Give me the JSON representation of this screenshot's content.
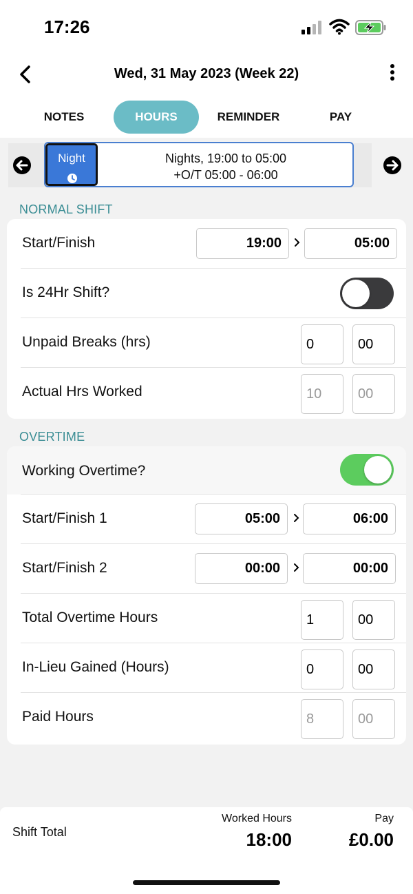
{
  "status_bar": {
    "time": "17:26"
  },
  "header": {
    "title": "Wed, 31 May 2023 (Week 22)"
  },
  "tabs": [
    {
      "label": "NOTES",
      "active": false
    },
    {
      "label": "HOURS",
      "active": true
    },
    {
      "label": "REMINDER",
      "active": false
    },
    {
      "label": "PAY",
      "active": false
    }
  ],
  "shift": {
    "badge": "Night",
    "line1": "Nights, 19:00 to 05:00",
    "line2": "+O/T 05:00 - 06:00"
  },
  "normal_shift": {
    "title": "NORMAL SHIFT",
    "start_finish": {
      "label": "Start/Finish",
      "start": "19:00",
      "finish": "05:00"
    },
    "is_24hr": {
      "label": "Is 24Hr Shift?",
      "on": false
    },
    "unpaid_breaks": {
      "label": "Unpaid Breaks (hrs)",
      "hours": "0",
      "minutes": "00"
    },
    "actual_hrs": {
      "label": "Actual Hrs Worked",
      "hours": "10",
      "minutes": "00"
    }
  },
  "overtime": {
    "title": "OVERTIME",
    "working_overtime": {
      "label": "Working Overtime?",
      "on": true
    },
    "start_finish_1": {
      "label": "Start/Finish 1",
      "start": "05:00",
      "finish": "06:00"
    },
    "start_finish_2": {
      "label": "Start/Finish 2",
      "start": "00:00",
      "finish": "00:00"
    },
    "total_ot": {
      "label": "Total Overtime Hours",
      "hours": "1",
      "minutes": "00"
    },
    "in_lieu": {
      "label": "In-Lieu Gained (Hours)",
      "hours": "0",
      "minutes": "00"
    },
    "paid_hours": {
      "label": "Paid Hours",
      "hours": "8",
      "minutes": "00"
    }
  },
  "footer": {
    "label": "Shift Total",
    "worked_label": "Worked Hours",
    "worked_value": "18:00",
    "pay_label": "Pay",
    "pay_value": "£0.00"
  },
  "colors": {
    "accent": "#6bbcc6",
    "section_title": "#3a8d94",
    "badge": "#3a78d8",
    "toggle_on": "#5ccc5e",
    "toggle_off": "#3a3a3c"
  }
}
